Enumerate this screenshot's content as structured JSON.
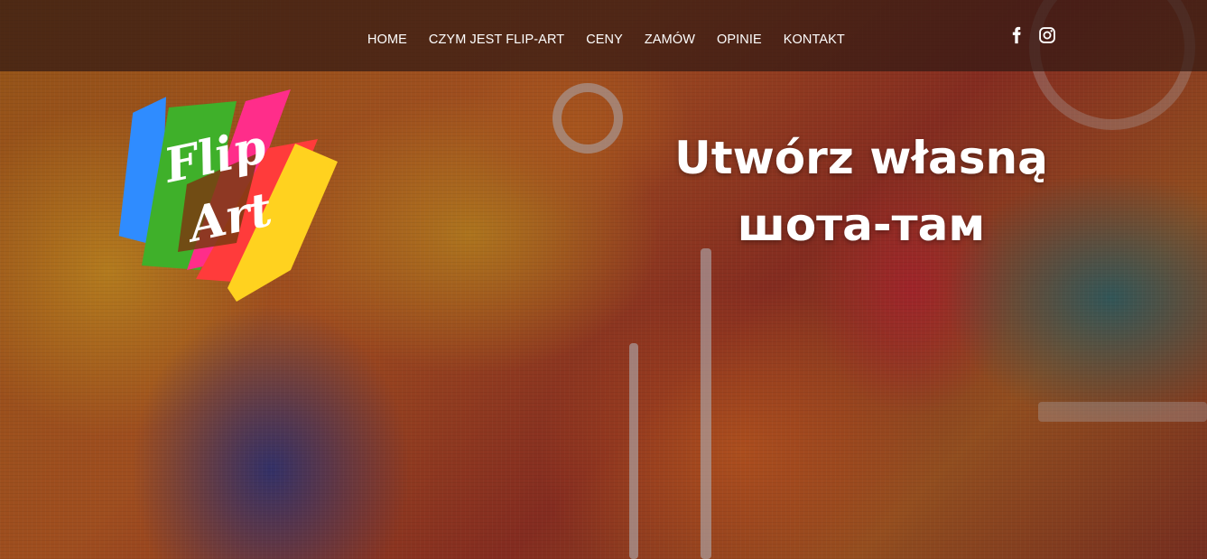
{
  "nav": {
    "items": [
      {
        "label": "HOME"
      },
      {
        "label": "CZYM JEST FLIP-ART"
      },
      {
        "label": "CENY"
      },
      {
        "label": "ZAMÓW"
      },
      {
        "label": "OPINIE"
      },
      {
        "label": "KONTAKT"
      }
    ]
  },
  "social": {
    "icons": [
      "facebook-icon",
      "instagram-icon"
    ]
  },
  "logo": {
    "text_line1": "Flip",
    "text_line2": "Art",
    "colors": [
      "#2f8cff",
      "#3fb02a",
      "#ff2d8a",
      "#ff3b3b",
      "#ffd21f",
      "#ff9a1f"
    ]
  },
  "hero": {
    "title_line1": "Utwórz własną",
    "title_line2": "шота-там"
  },
  "colors": {
    "nav_bg": "#32191499",
    "text": "#ffffff"
  }
}
